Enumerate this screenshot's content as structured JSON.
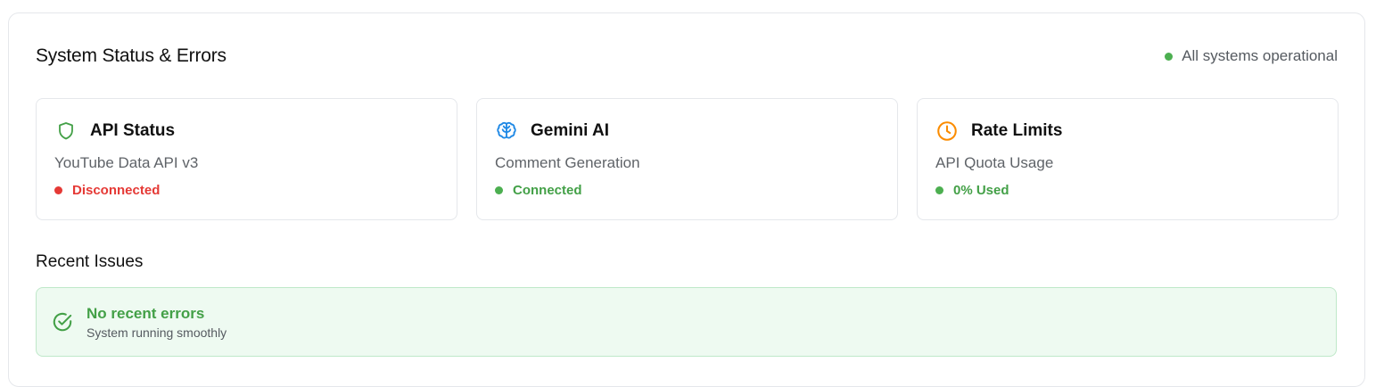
{
  "panel": {
    "title": "System Status & Errors",
    "overall_status": "All systems operational",
    "overall_status_color": "#4caf50"
  },
  "cards": [
    {
      "icon": "shield-icon",
      "icon_color": "#43a047",
      "title": "API Status",
      "subtitle": "YouTube Data API v3",
      "status": "Disconnected",
      "status_color": "#e53935"
    },
    {
      "icon": "brain-icon",
      "icon_color": "#1e88e5",
      "title": "Gemini AI",
      "subtitle": "Comment Generation",
      "status": "Connected",
      "status_color": "#43a047"
    },
    {
      "icon": "clock-icon",
      "icon_color": "#fb8c00",
      "title": "Rate Limits",
      "subtitle": "API Quota Usage",
      "status": "0% Used",
      "status_color": "#43a047"
    }
  ],
  "recent_issues": {
    "title": "Recent Issues",
    "message_title": "No recent errors",
    "message_subtitle": "System running smoothly",
    "icon": "check-circle-icon",
    "accent_color": "#43a047"
  }
}
